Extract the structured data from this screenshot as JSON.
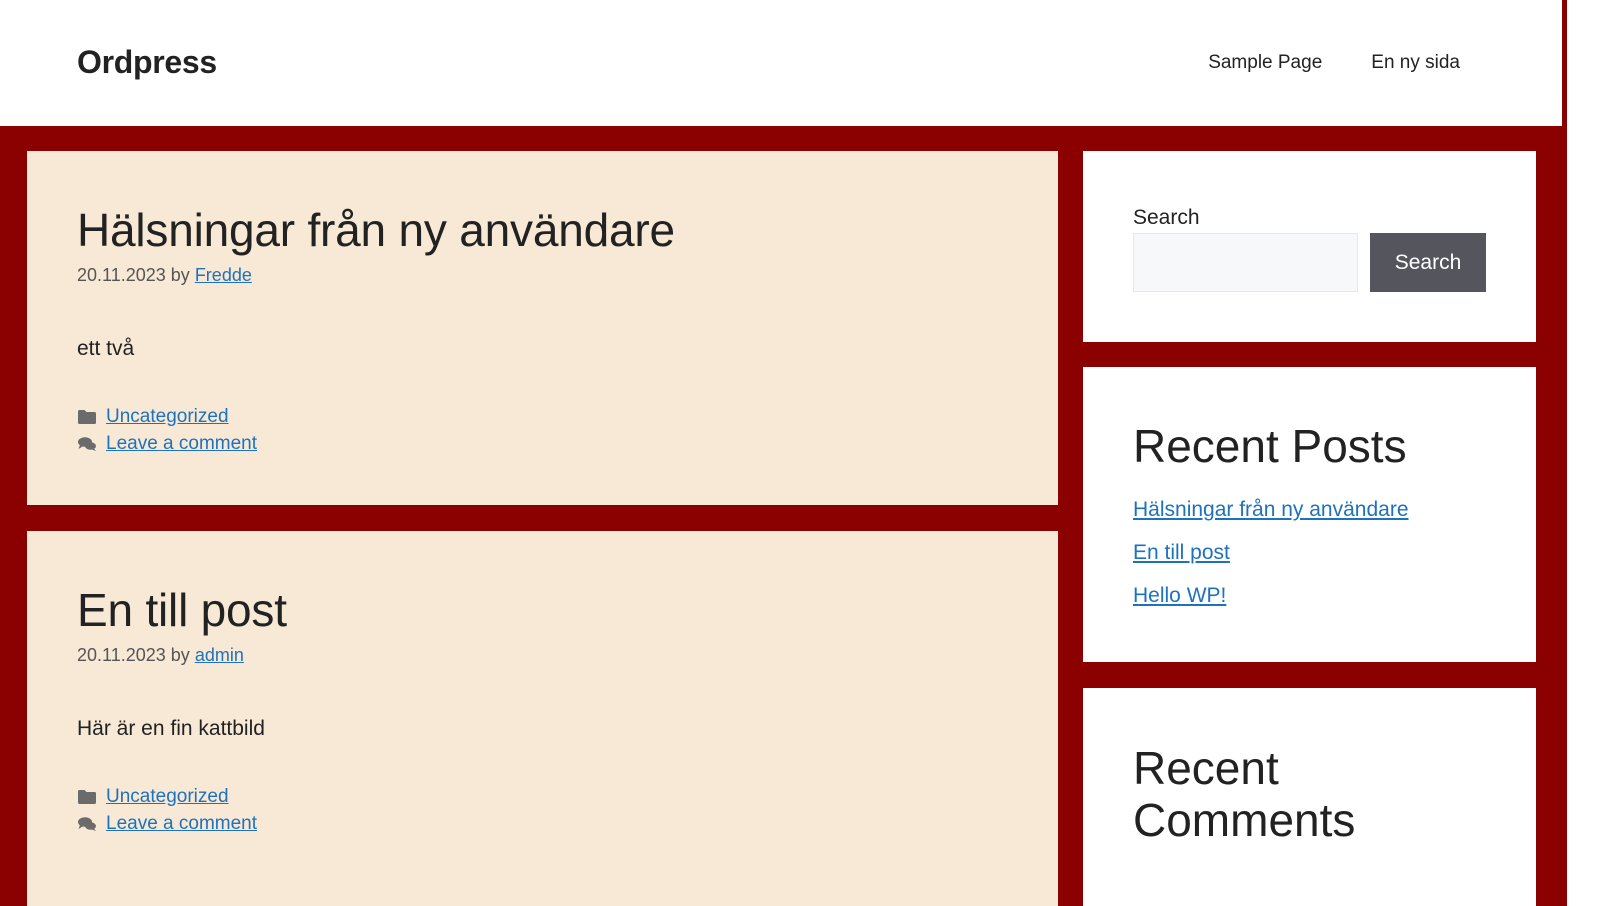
{
  "header": {
    "site_title": "Ordpress",
    "nav": [
      "Sample Page",
      "En ny sida"
    ]
  },
  "posts": [
    {
      "title": "Hälsningar från ny användare",
      "date": "20.11.2023",
      "by": "by",
      "author": "Fredde",
      "content": "ett två",
      "category": "Uncategorized",
      "comment_link": "Leave a comment"
    },
    {
      "title": "En till post",
      "date": "20.11.2023",
      "by": "by",
      "author": "admin",
      "content": "Här är en fin kattbild",
      "category": "Uncategorized",
      "comment_link": "Leave a comment"
    }
  ],
  "sidebar": {
    "search": {
      "label": "Search",
      "button": "Search",
      "value": ""
    },
    "recent_posts": {
      "title": "Recent Posts",
      "items": [
        "Hälsningar från ny användare",
        "En till post",
        "Hello WP!"
      ]
    },
    "recent_comments": {
      "title": "Recent Comments"
    }
  },
  "colors": {
    "accent_background": "#8b0000",
    "post_card": "#f8e9d6",
    "link": "#1e72bd",
    "button": "#55555e"
  },
  "icons": {
    "category": "folder-icon",
    "comments": "comments-icon"
  }
}
